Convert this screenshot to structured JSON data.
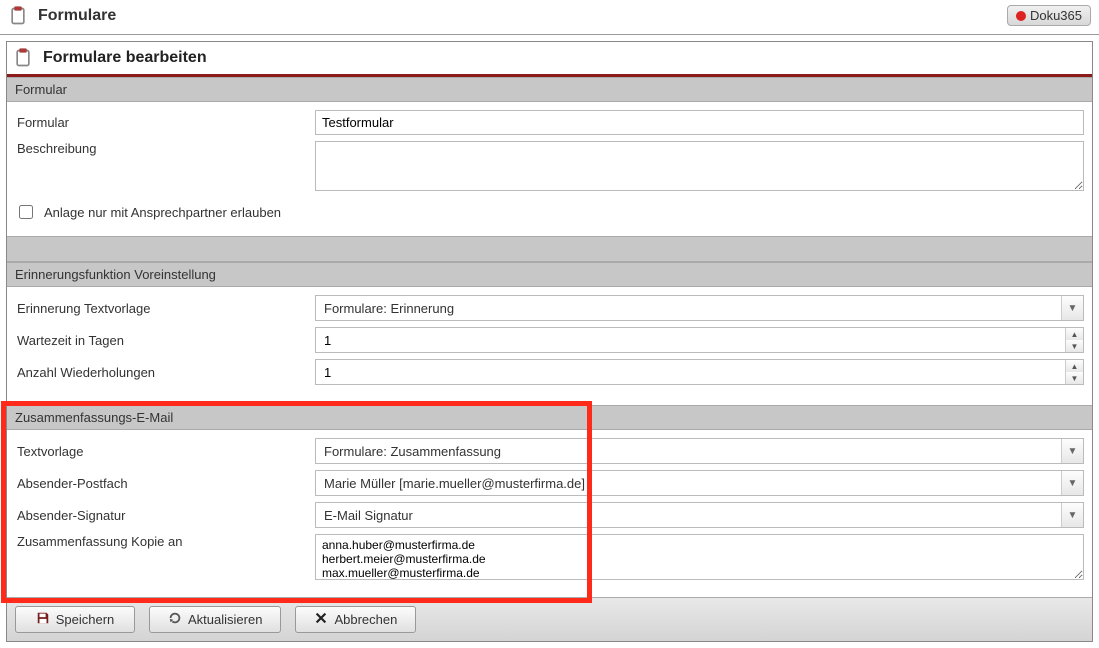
{
  "topbar": {
    "title": "Formulare",
    "doku_btn": "Doku365"
  },
  "panel": {
    "title": "Formulare bearbeiten"
  },
  "sections": {
    "formular": {
      "title": "Formular",
      "label_formular": "Formular",
      "value_formular": "Testformular",
      "label_beschreibung": "Beschreibung",
      "value_beschreibung": "",
      "checkbox_label": "Anlage nur mit Ansprechpartner erlauben"
    },
    "erinnerung": {
      "title": "Erinnerungsfunktion Voreinstellung",
      "label_vorlage": "Erinnerung Textvorlage",
      "value_vorlage": "Formulare: Erinnerung",
      "label_wartezeit": "Wartezeit in Tagen",
      "value_wartezeit": "1",
      "label_wiederholungen": "Anzahl Wiederholungen",
      "value_wiederholungen": "1"
    },
    "zusammenfassung": {
      "title": "Zusammenfassungs-E-Mail",
      "label_textvorlage": "Textvorlage",
      "value_textvorlage": "Formulare: Zusammenfassung",
      "label_postfach": "Absender-Postfach",
      "value_postfach": "Marie Müller [marie.mueller@musterfirma.de]",
      "label_signatur": "Absender-Signatur",
      "value_signatur": "E-Mail Signatur",
      "label_kopie": "Zusammenfassung Kopie an",
      "value_kopie": "anna.huber@musterfirma.de\nherbert.meier@musterfirma.de\nmax.mueller@musterfirma.de"
    }
  },
  "footer": {
    "save": "Speichern",
    "refresh": "Aktualisieren",
    "cancel": "Abbrechen"
  }
}
